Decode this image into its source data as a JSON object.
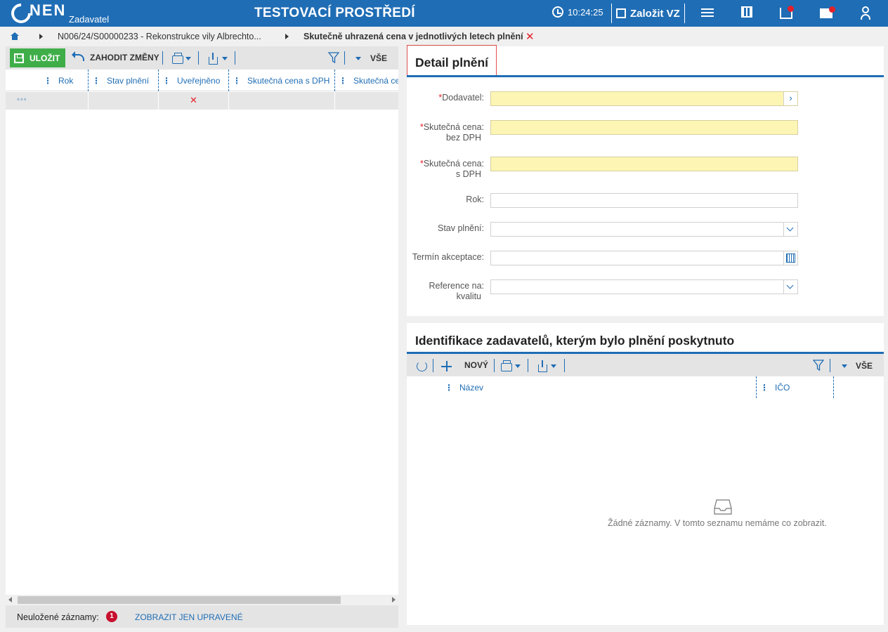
{
  "app": {
    "logo_text": "NEN",
    "logo_sub": "Zadavatel",
    "env_title": "TESTOVACÍ PROSTŘEDÍ",
    "clock": "10:24:25",
    "create_label": "Založit VZ",
    "icons": [
      "menu-icon",
      "calculator-icon",
      "inbox-icon",
      "mail-icon",
      "user-icon"
    ],
    "accent_color": "#1f6db5"
  },
  "breadcrumb": {
    "items": [
      "N006/24/S00000233 - Rekonstrukce vily Albrechto...",
      "Skutečně uhrazená cena v jednotlivých letech plnění"
    ],
    "close": "✕"
  },
  "left": {
    "toolbar": {
      "save_label": "ULOŽIT",
      "discard_label": "ZAHODIT ZMĚNY",
      "filter_scope": "VŠE"
    },
    "columns": [
      "Rok",
      "Stav plnění",
      "Uveřejněno",
      "Skutečná cena s DPH",
      "Skutečná cena bez DPH"
    ],
    "row": {
      "marker": "◦◦◦",
      "published": "✕"
    },
    "footer": {
      "unsaved_label": "Neuložené záznamy:",
      "unsaved_count": "1",
      "show_modified_label": "ZOBRAZIT JEN UPRAVENÉ"
    }
  },
  "detail": {
    "title": "Detail plnění",
    "fields": [
      {
        "label": "Dodavatel:",
        "required": true,
        "value": "",
        "type": "lookup"
      },
      {
        "label_line1": "Skutečná cena:",
        "label_line2": "bez DPH",
        "required": true,
        "value": "",
        "type": "number"
      },
      {
        "label_line1": "Skutečná cena:",
        "label_line2": "s DPH",
        "required": true,
        "value": "",
        "type": "number"
      },
      {
        "label": "Rok:",
        "required": false,
        "value": "",
        "type": "text"
      },
      {
        "label": "Stav plnění:",
        "required": false,
        "value": "",
        "type": "select"
      },
      {
        "label": "Termín akceptace:",
        "required": false,
        "value": "",
        "type": "date"
      },
      {
        "label_line1": "Reference na:",
        "label_line2": "kvalitu",
        "required": false,
        "value": "",
        "type": "select"
      }
    ]
  },
  "identification": {
    "title": "Identifikace zadavatelů, kterým bylo plnění poskytnuto",
    "toolbar": {
      "new_label": "NOVÝ",
      "filter_scope": "VŠE"
    },
    "columns": [
      "Název",
      "IČO"
    ],
    "empty_text": "Žádné záznamy. V tomto seznamu nemáme co zobrazit."
  }
}
